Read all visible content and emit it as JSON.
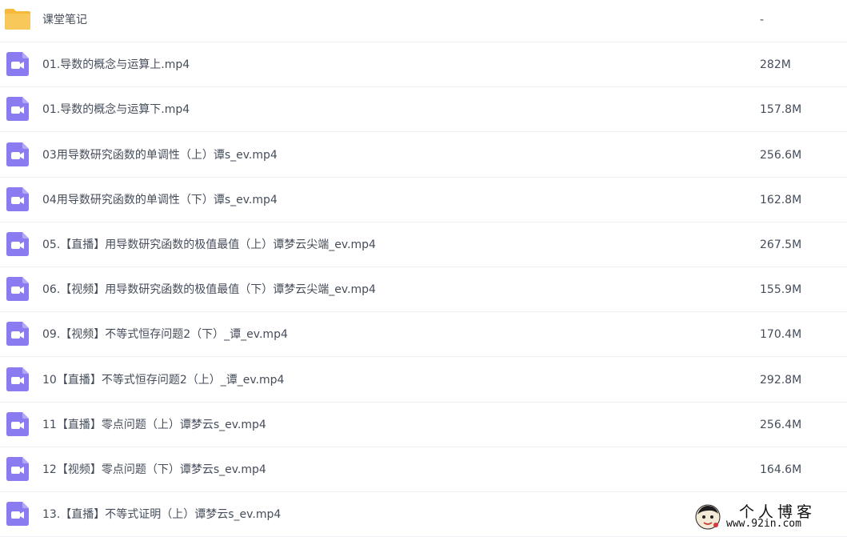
{
  "colors": {
    "folder": "#f9c85a",
    "video_icon": "#8b7bf0",
    "text": "#454d5a",
    "divider": "#eef0f4"
  },
  "files": [
    {
      "name": "课堂笔记",
      "size": "-",
      "icon": "folder-icon"
    },
    {
      "name": "01.导数的概念与运算上.mp4",
      "size": "282M",
      "icon": "video-file-icon"
    },
    {
      "name": "01.导数的概念与运算下.mp4",
      "size": "157.8M",
      "icon": "video-file-icon"
    },
    {
      "name": "03用导数研究函数的单调性（上）谭s_ev.mp4",
      "size": "256.6M",
      "icon": "video-file-icon"
    },
    {
      "name": "04用导数研究函数的单调性（下）谭s_ev.mp4",
      "size": "162.8M",
      "icon": "video-file-icon"
    },
    {
      "name": "05.【直播】用导数研究函数的极值最值（上）谭梦云尖端_ev.mp4",
      "size": "267.5M",
      "icon": "video-file-icon"
    },
    {
      "name": "06.【视频】用导数研究函数的极值最值（下）谭梦云尖端_ev.mp4",
      "size": "155.9M",
      "icon": "video-file-icon"
    },
    {
      "name": "09.【视频】不等式恒存问题2（下）_谭_ev.mp4",
      "size": "170.4M",
      "icon": "video-file-icon"
    },
    {
      "name": "10【直播】不等式恒存问题2（上）_谭_ev.mp4",
      "size": "292.8M",
      "icon": "video-file-icon"
    },
    {
      "name": "11【直播】零点问题（上）谭梦云s_ev.mp4",
      "size": "256.4M",
      "icon": "video-file-icon"
    },
    {
      "name": "12【视频】零点问题（下）谭梦云s_ev.mp4",
      "size": "164.6M",
      "icon": "video-file-icon"
    },
    {
      "name": "13.【直播】不等式证明（上）谭梦云s_ev.mp4",
      "size": "",
      "icon": "video-file-icon"
    }
  ],
  "watermark": {
    "title": "个人博客",
    "url": "www.92in.com"
  }
}
